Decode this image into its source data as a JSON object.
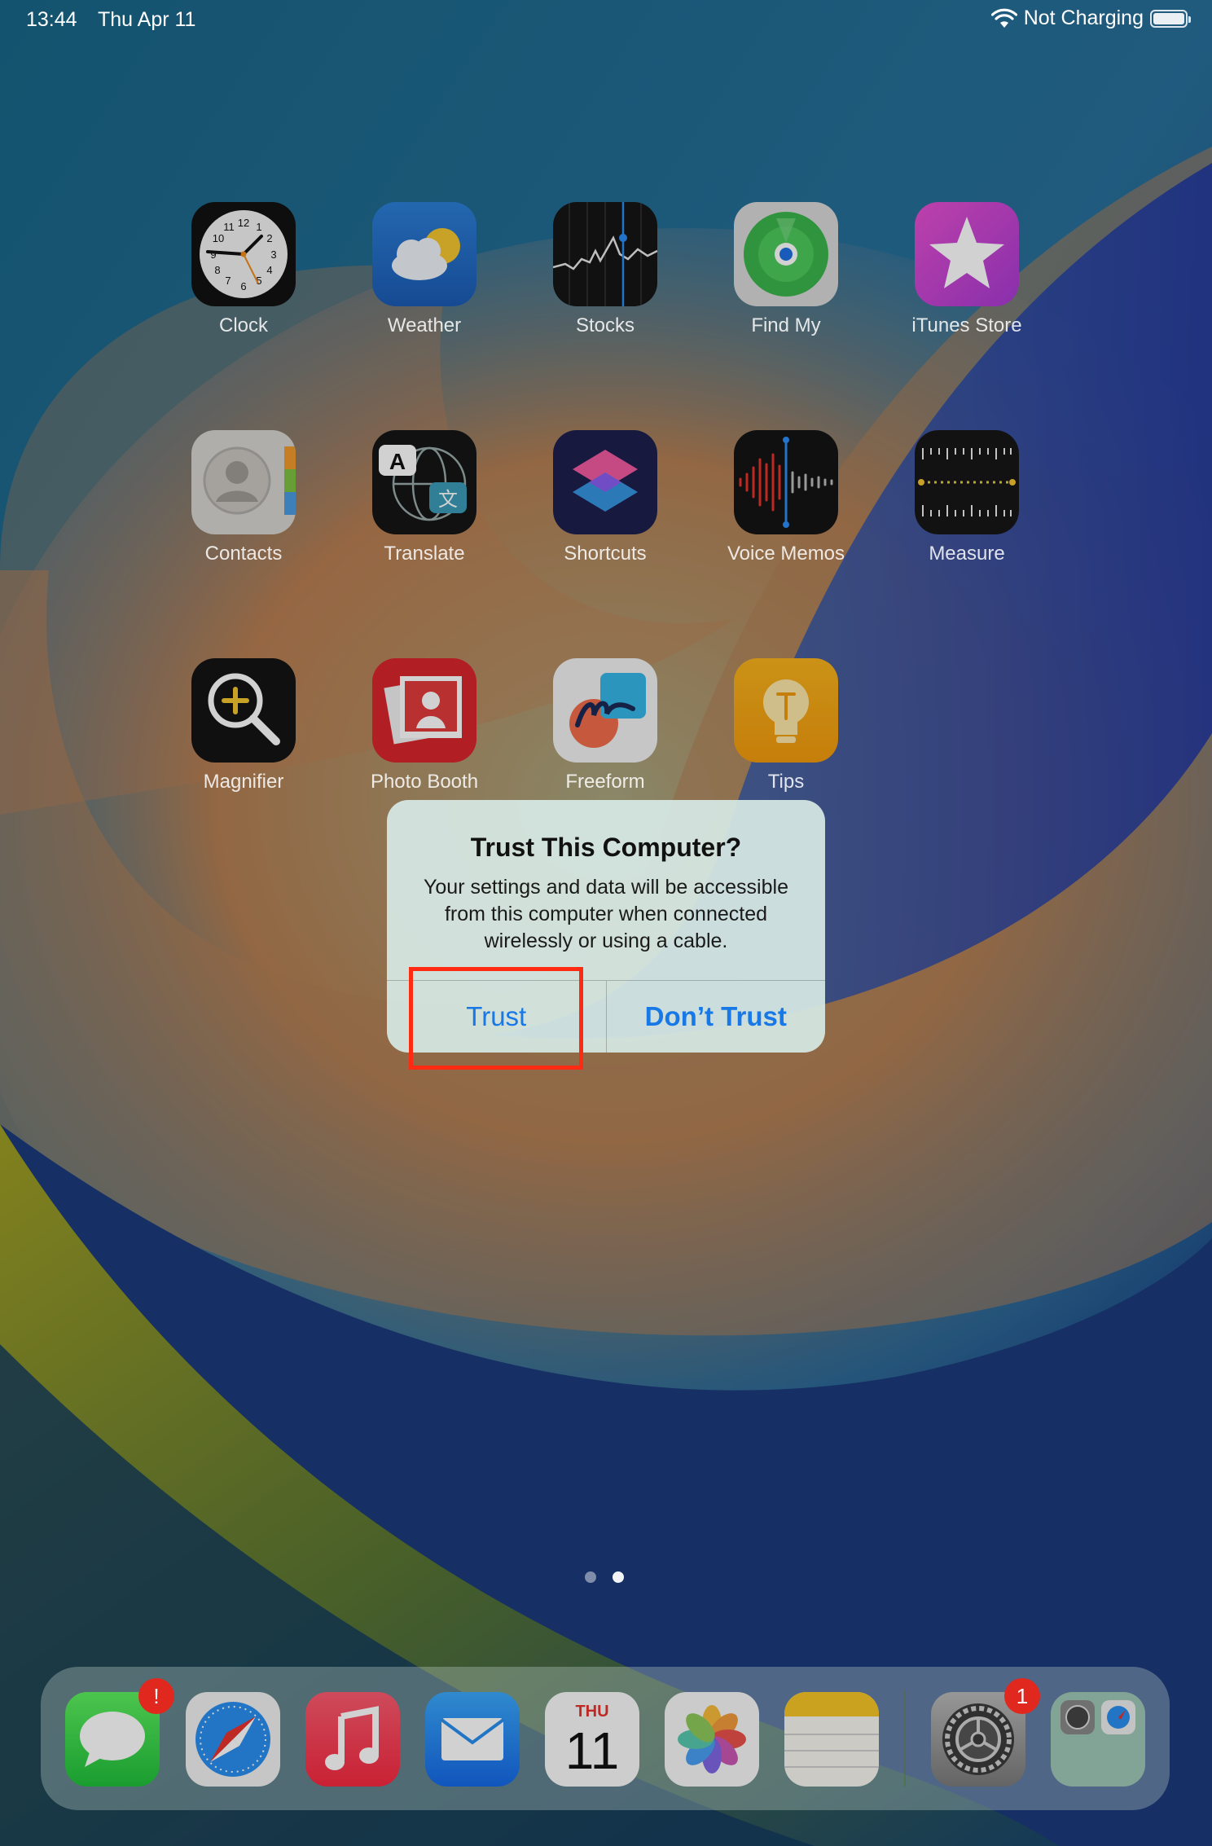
{
  "status_bar": {
    "time": "13:44",
    "date": "Thu Apr 11",
    "charging_status": "Not Charging",
    "wifi_icon": "wifi-icon",
    "battery_level": 1.0
  },
  "home_screen": {
    "apps": [
      {
        "label": "Clock",
        "icon": "clock-icon"
      },
      {
        "label": "Weather",
        "icon": "weather-icon"
      },
      {
        "label": "Stocks",
        "icon": "stocks-icon"
      },
      {
        "label": "Find My",
        "icon": "find-my-icon"
      },
      {
        "label": "iTunes Store",
        "icon": "itunes-store-icon"
      },
      {
        "label": "Contacts",
        "icon": "contacts-icon"
      },
      {
        "label": "Translate",
        "icon": "translate-icon"
      },
      {
        "label": "Shortcuts",
        "icon": "shortcuts-icon"
      },
      {
        "label": "Voice Memos",
        "icon": "voice-memos-icon"
      },
      {
        "label": "Measure",
        "icon": "measure-icon"
      },
      {
        "label": "Magnifier",
        "icon": "magnifier-icon"
      },
      {
        "label": "Photo Booth",
        "icon": "photo-booth-icon"
      },
      {
        "label": "Freeform",
        "icon": "freeform-icon"
      },
      {
        "label": "Tips",
        "icon": "tips-icon"
      }
    ],
    "page_count": 2,
    "current_page": 2
  },
  "alert": {
    "title": "Trust This Computer?",
    "message": "Your settings and data will be accessible from this computer when connected wirelessly or using a cable.",
    "buttons": {
      "trust": "Trust",
      "dont_trust": "Don’t Trust"
    }
  },
  "dock": {
    "apps": [
      {
        "icon": "messages-icon",
        "badge": "!"
      },
      {
        "icon": "safari-icon"
      },
      {
        "icon": "music-icon"
      },
      {
        "icon": "mail-icon"
      },
      {
        "icon": "calendar-icon",
        "weekday": "THU",
        "day": "11"
      },
      {
        "icon": "photos-icon"
      },
      {
        "icon": "notes-icon"
      },
      {
        "icon": "settings-icon",
        "badge": "1"
      },
      {
        "icon": "app-library-icon"
      }
    ]
  },
  "colors": {
    "accent_blue": "#1778e6",
    "highlight_red": "#ff2a12",
    "badge_red": "#e0281f"
  }
}
